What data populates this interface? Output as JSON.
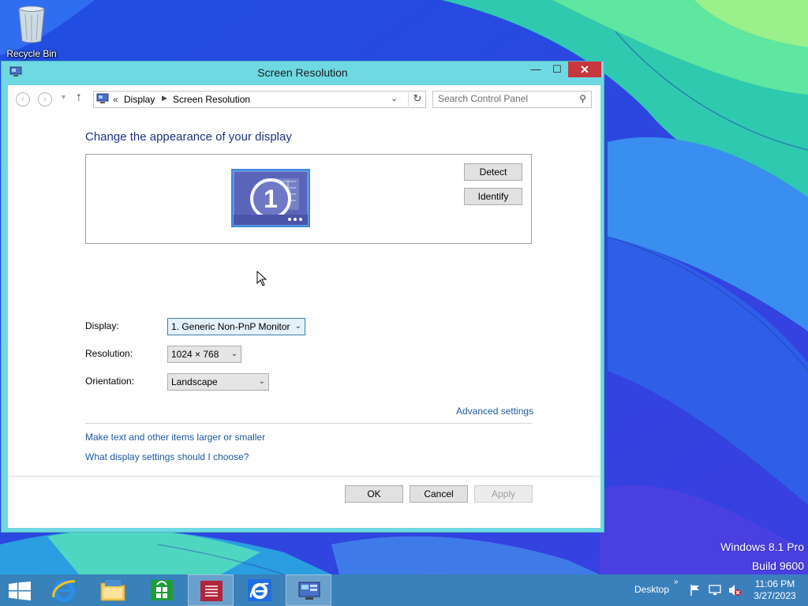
{
  "desktop": {
    "recycle_bin_label": "Recycle Bin",
    "watermark_line1": "Windows 8.1 Pro",
    "watermark_line2": "Build 9600"
  },
  "window": {
    "title": "Screen Resolution",
    "title_buttons": {
      "minimize": "—",
      "maximize": "☐",
      "close": "✕"
    },
    "accent_color": "#6fd9e3",
    "close_color": "#c7373e"
  },
  "navbar": {
    "back_icon": "‹",
    "forward_icon": "›",
    "up_icon": "↑",
    "breadcrumb_prefix": "«",
    "breadcrumbs": [
      "Display",
      "Screen Resolution"
    ],
    "search_placeholder": "Search Control Panel"
  },
  "main": {
    "heading": "Change the appearance of your display",
    "monitor_number": "1",
    "detect_label": "Detect",
    "identify_label": "Identify",
    "display_label": "Display:",
    "display_value": "1. Generic Non-PnP Monitor",
    "resolution_label": "Resolution:",
    "resolution_value": "1024 × 768",
    "orientation_label": "Orientation:",
    "orientation_value": "Landscape",
    "advanced_settings": "Advanced settings",
    "link_text_size": "Make text and other items larger or smaller",
    "link_help": "What display settings should I choose?",
    "ok_label": "OK",
    "cancel_label": "Cancel",
    "apply_label": "Apply"
  },
  "taskbar": {
    "items": [
      "start-button",
      "internet-explorer",
      "file-explorer",
      "store",
      "app-red",
      "internet-explorer-2",
      "control-panel"
    ],
    "desktop_label": "Desktop",
    "chevron": "»",
    "time": "11:06 PM",
    "date": "3/27/2023"
  }
}
